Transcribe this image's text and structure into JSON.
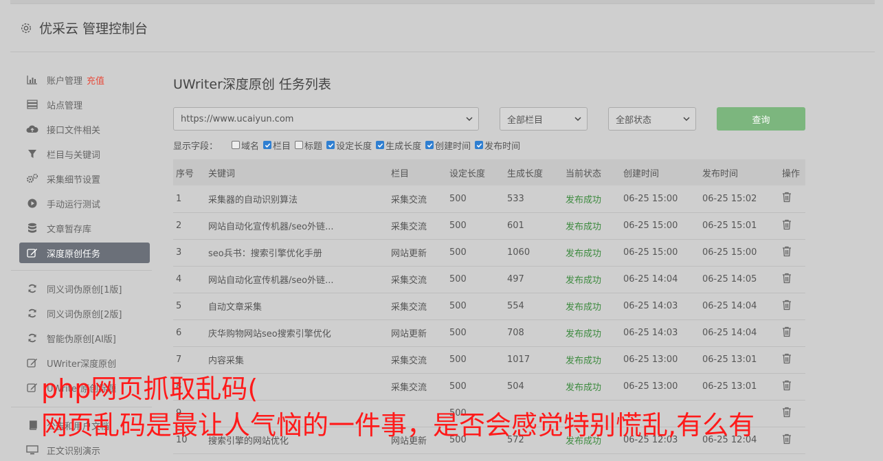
{
  "header": {
    "title": "优采云 管理控制台"
  },
  "sidebar": {
    "items": [
      {
        "label": "账户管理",
        "badge": "充值",
        "icon": "bar-chart-icon"
      },
      {
        "label": "站点管理",
        "icon": "server-icon"
      },
      {
        "label": "接口文件相关",
        "icon": "cloud-upload-icon"
      },
      {
        "label": "栏目与关键词",
        "icon": "filter-icon"
      },
      {
        "label": "采集细节设置",
        "icon": "gears-icon"
      },
      {
        "label": "手动运行测试",
        "icon": "play-icon"
      },
      {
        "label": "文章暂存库",
        "icon": "database-icon"
      },
      {
        "label": "深度原创任务",
        "icon": "edit-icon",
        "active": true
      }
    ],
    "items2": [
      {
        "label": "同义词伪原创[1版]",
        "icon": "refresh-icon"
      },
      {
        "label": "同义词伪原创[2版]",
        "icon": "refresh-icon"
      },
      {
        "label": "智能伪原创[AI版]",
        "icon": "refresh-icon"
      },
      {
        "label": "UWriter深度原创",
        "icon": "edit-icon"
      },
      {
        "label": "UWriter原创标题",
        "icon": "edit-icon"
      }
    ],
    "items3": [
      {
        "label": "公告和用户文档",
        "icon": "book-icon"
      },
      {
        "label": "正文识别演示",
        "icon": "monitor-icon"
      }
    ]
  },
  "main": {
    "title": "UWriter深度原创 任务列表",
    "site_select": "https://www.ucaiyun.com",
    "column_select": "全部栏目",
    "status_select": "全部状态",
    "query_label": "查询",
    "fields_label": "显示字段：",
    "fields": [
      {
        "label": "域名",
        "checked": false
      },
      {
        "label": "栏目",
        "checked": true
      },
      {
        "label": "标题",
        "checked": false
      },
      {
        "label": "设定长度",
        "checked": true
      },
      {
        "label": "生成长度",
        "checked": true
      },
      {
        "label": "创建时间",
        "checked": true
      },
      {
        "label": "发布时间",
        "checked": true
      }
    ],
    "columns": [
      "序号",
      "关键词",
      "栏目",
      "设定长度",
      "生成长度",
      "当前状态",
      "创建时间",
      "发布时间",
      "操作"
    ],
    "rows": [
      [
        "1",
        "采集器的自动识别算法",
        "采集交流",
        "500",
        "533",
        "发布成功",
        "06-25 15:00",
        "06-25 15:02"
      ],
      [
        "2",
        "网站自动化宣传机器/seo外链...",
        "采集交流",
        "500",
        "601",
        "发布成功",
        "06-25 15:00",
        "06-25 15:01"
      ],
      [
        "3",
        "seo兵书：搜索引擎优化手册",
        "网站更新",
        "500",
        "1060",
        "发布成功",
        "06-25 15:00",
        "06-25 15:00"
      ],
      [
        "4",
        "网站自动化宣传机器/seo外链...",
        "采集交流",
        "500",
        "497",
        "发布成功",
        "06-25 14:04",
        "06-25 14:05"
      ],
      [
        "5",
        "自动文章采集",
        "采集交流",
        "500",
        "554",
        "发布成功",
        "06-25 14:03",
        "06-25 14:04"
      ],
      [
        "6",
        "庆华购物网站seo搜索引擎优化",
        "网站更新",
        "500",
        "708",
        "发布成功",
        "06-25 14:03",
        "06-25 14:04"
      ],
      [
        "7",
        "内容采集",
        "采集交流",
        "500",
        "1017",
        "发布成功",
        "06-25 13:00",
        "06-25 13:01"
      ],
      [
        "8",
        "",
        "采集交流",
        "500",
        "504",
        "发布成功",
        "06-25 13:00",
        "06-25 13:01"
      ],
      [
        "9",
        "",
        "",
        "500",
        "",
        "",
        "",
        ""
      ],
      [
        "10",
        "搜索引擎的网站优化",
        "网站更新",
        "500",
        "572",
        "发布成功",
        "06-25 12:03",
        "06-25 12:04"
      ]
    ]
  },
  "overlay": {
    "line1": "php网页抓取乱码(",
    "line2": "网页乱码是最让人气恼的一件事，是否会感觉特别慌乱,有么有"
  }
}
